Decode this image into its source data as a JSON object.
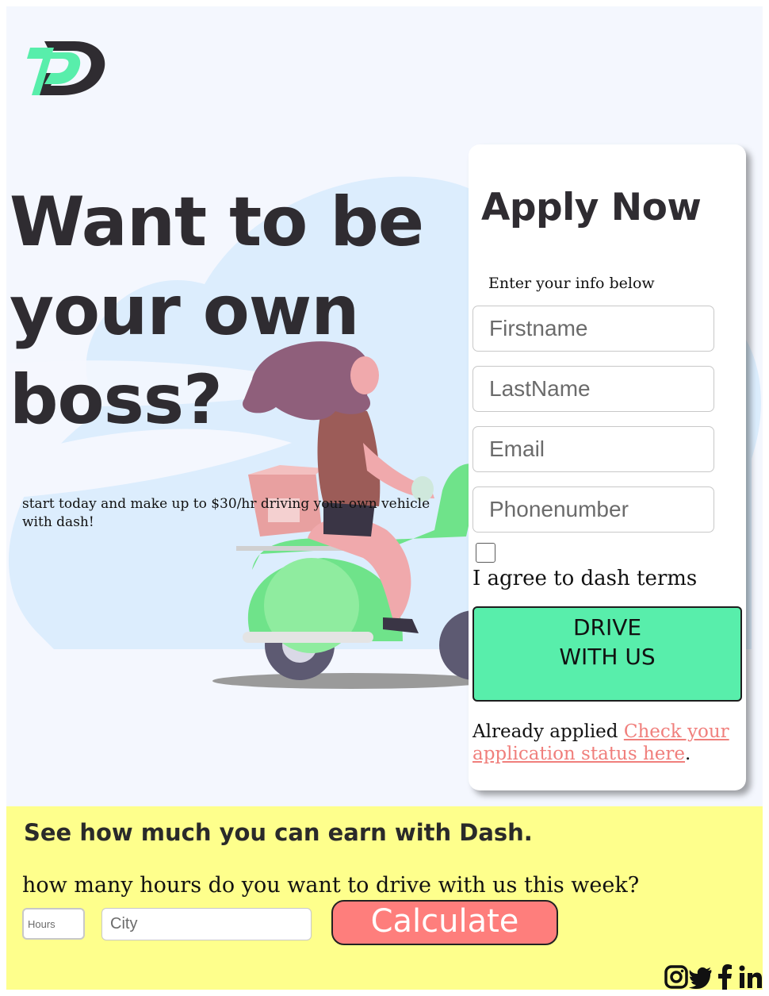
{
  "brand": {
    "logo_icon": "dash-d-logo-icon",
    "colors": {
      "mint": "#58eeab",
      "coral": "#fe7e7c",
      "yellow": "#feff8c",
      "dark": "#2f2c31"
    }
  },
  "hero": {
    "headline": "Want to be your own boss?",
    "subtext": "start today and make up to $30/hr driving your own vehicle with dash!",
    "illustration": "woman-on-scooter-illustration"
  },
  "apply": {
    "title": "Apply Now",
    "hint": "Enter your info below",
    "fields": {
      "firstname": {
        "placeholder": "Firstname",
        "value": ""
      },
      "lastname": {
        "placeholder": "LastName",
        "value": ""
      },
      "email": {
        "placeholder": "Email",
        "value": ""
      },
      "phone": {
        "placeholder": "Phonenumber",
        "value": ""
      }
    },
    "agree_label": "I agree to dash terms",
    "agree_checked": false,
    "submit_label": "DRIVE WITH US",
    "applied_text": "Already applied",
    "status_link": "Check your application status here",
    "period": "."
  },
  "earn": {
    "title": "See how much you can earn with Dash.",
    "question": "how many hours do you want to drive with us this week?",
    "hours_placeholder": "Hours",
    "city_placeholder": "City",
    "calculate_label": "Calculate"
  },
  "social": [
    "instagram-icon",
    "twitter-icon",
    "facebook-icon",
    "linkedin-icon"
  ]
}
